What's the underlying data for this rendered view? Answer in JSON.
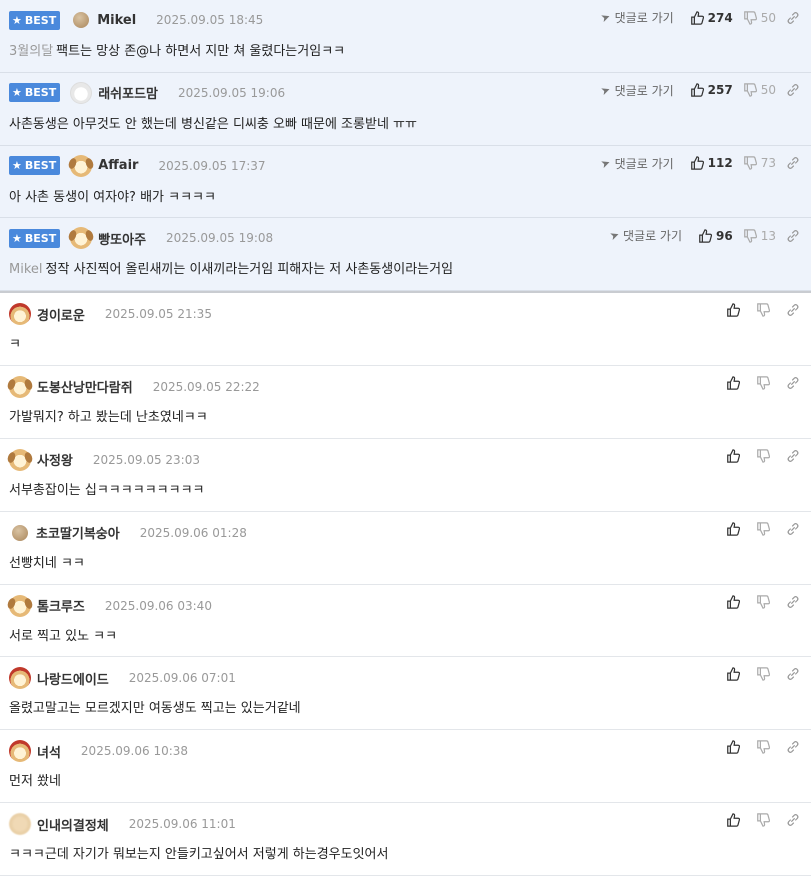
{
  "best_badge": "BEST",
  "reply_link_label": "댓글로 가기",
  "best_comments": [
    {
      "nick": "Mikel",
      "avatar": "dot",
      "date": "2025.09.05 18:45",
      "mention": "3월의달",
      "text": "팩트는 망상 존@나 하면서 지만 쳐 울렸다는거임ㅋㅋ",
      "likes": "274",
      "dislikes": "50"
    },
    {
      "nick": "래쉬포드맘",
      "avatar": "white",
      "date": "2025.09.05 19:06",
      "mention": "",
      "text": "사촌동생은 아무것도 안 했는데 병신같은 디씨충 오빠 때문에 조롱받네 ㅠㅠ",
      "likes": "257",
      "dislikes": "50"
    },
    {
      "nick": "Affair",
      "avatar": "puppy",
      "date": "2025.09.05 17:37",
      "mention": "",
      "text": "아 사촌 동생이 여자야? 배가 ㅋㅋㅋㅋ",
      "likes": "112",
      "dislikes": "73"
    },
    {
      "nick": "빵또아주",
      "avatar": "puppy",
      "date": "2025.09.05 19:08",
      "mention": "Mikel",
      "text": "정작 사진찍어 올린새끼는 이새끼라는거임 피해자는 저 사촌동생이라는거임",
      "likes": "96",
      "dislikes": "13"
    }
  ],
  "comments": [
    {
      "nick": "경이로운",
      "avatar": "red",
      "date": "2025.09.05 21:35",
      "text": "ㅋ"
    },
    {
      "nick": "도봉산낭만다람쥐",
      "avatar": "puppy",
      "date": "2025.09.05 22:22",
      "text": "가발뭐지? 하고 봤는데 난초였네ㅋㅋ"
    },
    {
      "nick": "사정왕",
      "avatar": "puppy",
      "date": "2025.09.05 23:03",
      "text": "서부총잡이는 십ㅋㅋㅋㅋㅋㅋㅋㅋㅋ"
    },
    {
      "nick": "초코딸기복숭아",
      "avatar": "dot",
      "date": "2025.09.06 01:28",
      "text": "선빵치네 ㅋㅋ"
    },
    {
      "nick": "톰크루즈",
      "avatar": "puppy",
      "date": "2025.09.06 03:40",
      "text": "서로 찍고 있노 ㅋㅋ"
    },
    {
      "nick": "나랑드에이드",
      "avatar": "red",
      "date": "2025.09.06 07:01",
      "text": "올렸고말고는 모르겠지만 여동생도 찍고는 있는거같네"
    },
    {
      "nick": "녀석",
      "avatar": "red",
      "date": "2025.09.06 10:38",
      "text": "먼저 쐈네"
    },
    {
      "nick": "인내의결정체",
      "avatar": "blur",
      "date": "2025.09.06 11:01",
      "text": "ㅋㅋㅋ근데 자기가 뭐보는지 안들키고싶어서 저렇게 하는경우도잇어서"
    }
  ]
}
